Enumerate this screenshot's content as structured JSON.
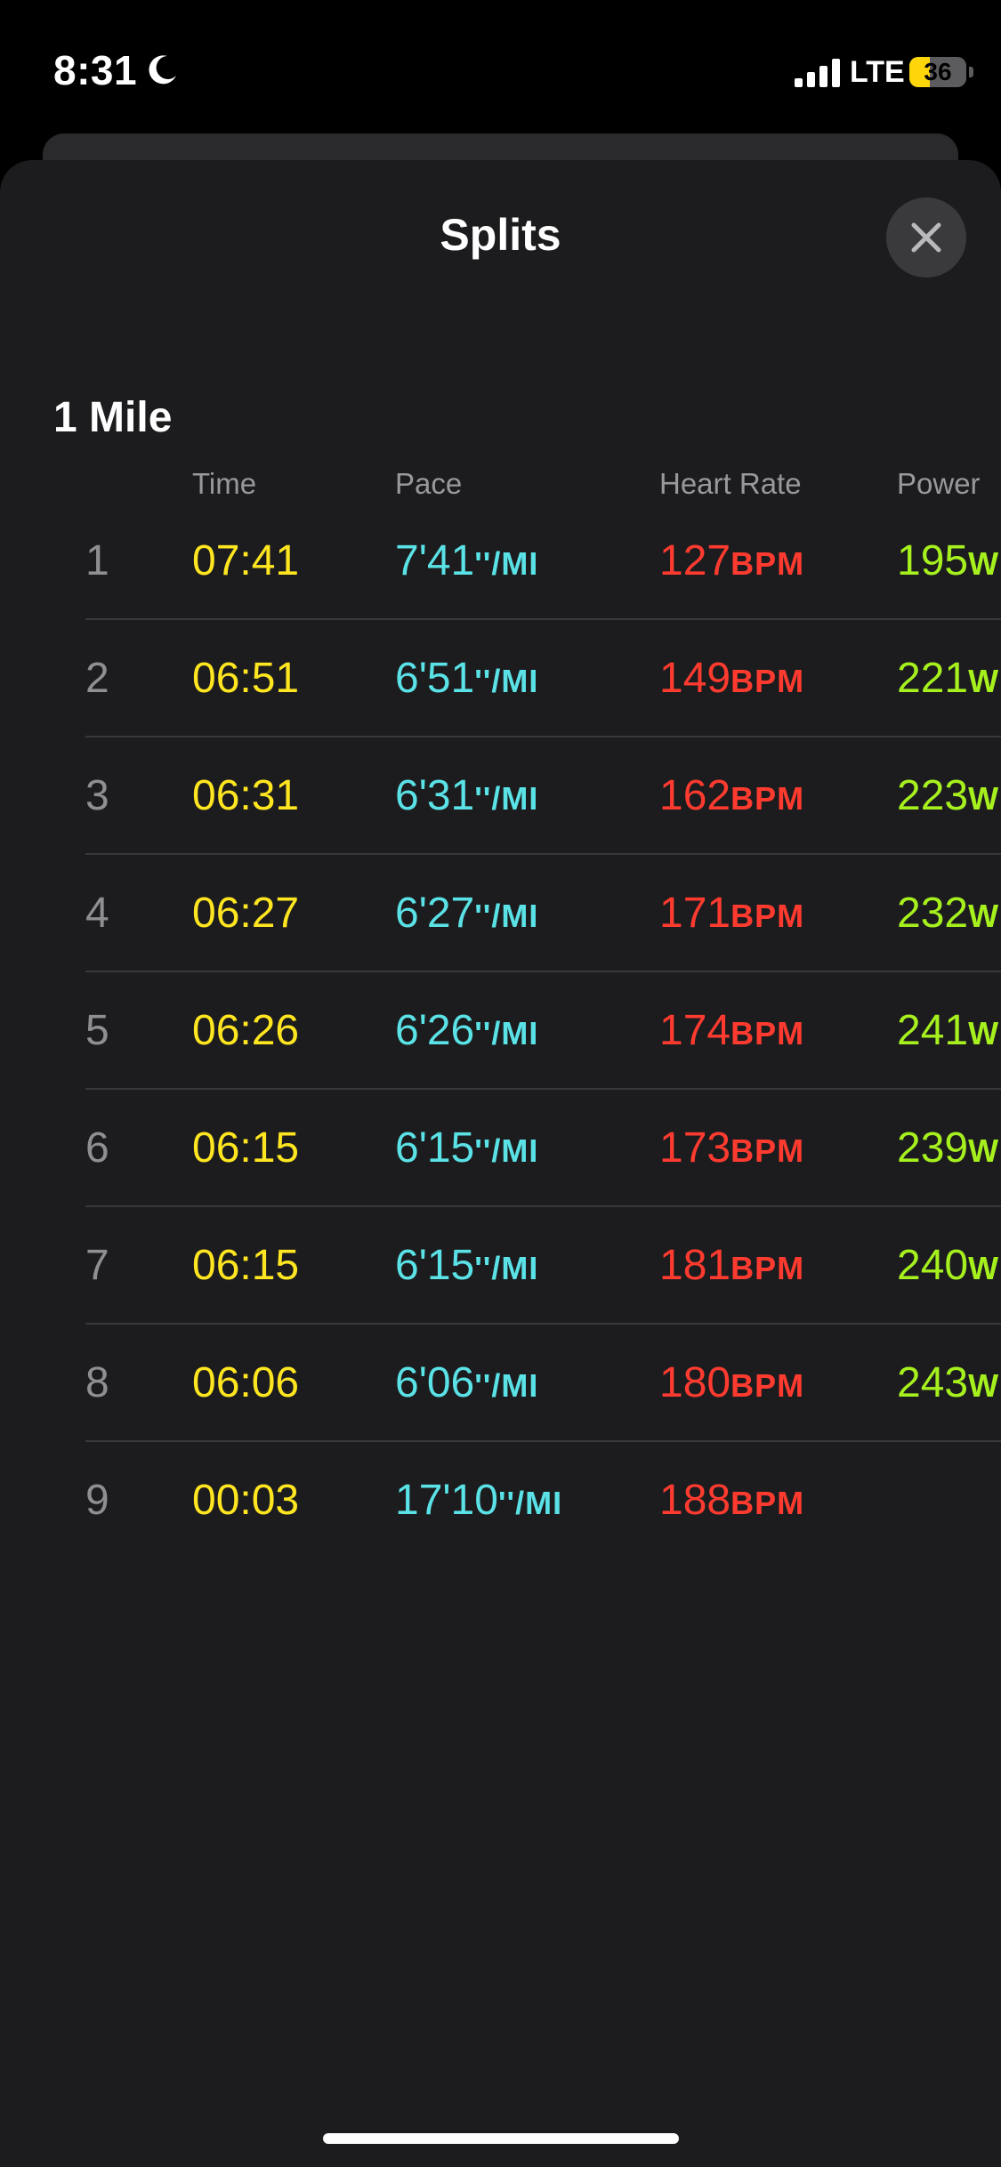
{
  "status_bar": {
    "time": "8:31",
    "network": "LTE",
    "battery_level": "36",
    "battery_fraction": 0.36,
    "battery_color": "#ffd60a"
  },
  "sheet": {
    "title": "Splits",
    "section_title": "1 Mile"
  },
  "columns": {
    "time": "Time",
    "pace": "Pace",
    "heart_rate": "Heart Rate",
    "power": "Power"
  },
  "units": {
    "pace": "''/MI",
    "heart_rate": "BPM",
    "power": "W"
  },
  "colors": {
    "time": "#ffe620",
    "pace": "#5ae2e6",
    "heart_rate": "#ff3b30",
    "power": "#a6f01e",
    "background": "#1c1c1e"
  },
  "splits": [
    {
      "index": "1",
      "time": "07:41",
      "pace": "7'41",
      "heart_rate": "127",
      "power": "195"
    },
    {
      "index": "2",
      "time": "06:51",
      "pace": "6'51",
      "heart_rate": "149",
      "power": "221"
    },
    {
      "index": "3",
      "time": "06:31",
      "pace": "6'31",
      "heart_rate": "162",
      "power": "223"
    },
    {
      "index": "4",
      "time": "06:27",
      "pace": "6'27",
      "heart_rate": "171",
      "power": "232"
    },
    {
      "index": "5",
      "time": "06:26",
      "pace": "6'26",
      "heart_rate": "174",
      "power": "241"
    },
    {
      "index": "6",
      "time": "06:15",
      "pace": "6'15",
      "heart_rate": "173",
      "power": "239"
    },
    {
      "index": "7",
      "time": "06:15",
      "pace": "6'15",
      "heart_rate": "181",
      "power": "240"
    },
    {
      "index": "8",
      "time": "06:06",
      "pace": "6'06",
      "heart_rate": "180",
      "power": "243"
    },
    {
      "index": "9",
      "time": "00:03",
      "pace": "17'10",
      "heart_rate": "188",
      "power": ""
    }
  ]
}
